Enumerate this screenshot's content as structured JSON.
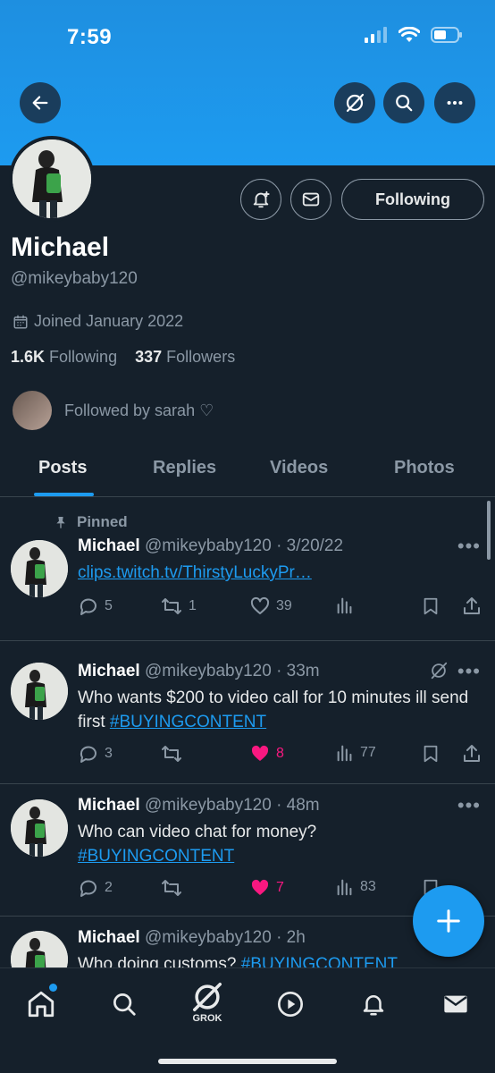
{
  "status_bar": {
    "time": "7:59"
  },
  "profile": {
    "display_name": "Michael",
    "handle": "@mikeybaby120",
    "joined": "Joined January 2022",
    "following_count": "1.6K",
    "following_label": "Following",
    "followers_count": "337",
    "followers_label": "Followers",
    "followed_by": "Followed by sarah ♡",
    "follow_button_label": "Following"
  },
  "tabs": [
    "Posts",
    "Replies",
    "Videos",
    "Photos"
  ],
  "pinned_label": "Pinned",
  "posts": [
    {
      "name": "Michael",
      "meta": "@mikeybaby120 · 3/20/22",
      "text": "",
      "link": "clips.twitch.tv/ThirstyLuckyPr…",
      "replies": "5",
      "reposts": "1",
      "likes": "39",
      "views": "",
      "liked": false
    },
    {
      "name": "Michael",
      "meta": "@mikeybaby120 · 33m",
      "text": "Who wants $200 to video call for 10 minutes ill send first",
      "link": "#BUYINGCONTENT",
      "replies": "3",
      "reposts": "",
      "likes": "8",
      "views": "77",
      "liked": true
    },
    {
      "name": "Michael",
      "meta": "@mikeybaby120 · 48m",
      "text": "Who can video chat for money?",
      "link": "#BUYINGCONTENT",
      "replies": "2",
      "reposts": "",
      "likes": "7",
      "views": "83",
      "liked": true
    },
    {
      "name": "Michael",
      "meta": "@mikeybaby120 · 2h",
      "text": "Who doing customs?",
      "link": "#BUYINGCONTENT"
    }
  ],
  "nav": {
    "grok_label": "GROK"
  },
  "colors": {
    "accent": "#1d9bf0",
    "background": "#15202b",
    "like": "#f91880",
    "muted": "#8b98a5"
  },
  "icons": [
    "back-arrow-icon",
    "grok-icon",
    "search-icon",
    "more-icon",
    "notification-bell-icon",
    "mail-icon",
    "calendar-icon",
    "pin-icon",
    "reply-icon",
    "repost-icon",
    "heart-icon",
    "views-icon",
    "bookmark-icon",
    "share-icon",
    "compose-plus-icon",
    "home-icon",
    "play-icon"
  ]
}
